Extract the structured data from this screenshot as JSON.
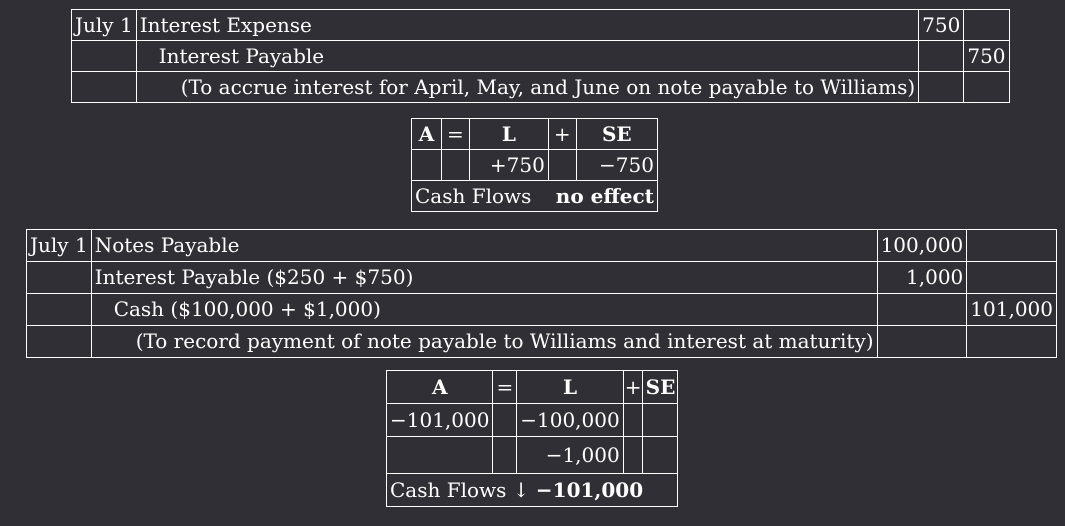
{
  "entry1": {
    "date": "July 1",
    "debit_account": "Interest Expense",
    "debit_amount": "750",
    "credit_account": "Interest Payable",
    "credit_amount": "750",
    "explanation": "(To accrue interest for April, May, and June on note payable to Williams)"
  },
  "effect1": {
    "h_a": "A",
    "h_eq": "=",
    "h_l": "L",
    "h_plus": "+",
    "h_se": "SE",
    "l_value": "+750",
    "se_value": "−750",
    "cash_label": "Cash Flows",
    "cash_value": "no effect"
  },
  "entry2": {
    "date": "July 1",
    "line1_account": "Notes Payable",
    "line1_amount": "100,000",
    "line2_account": "Interest Payable ($250 + $750)",
    "line2_amount": "1,000",
    "line3_account": "Cash ($100,000 + $1,000)",
    "line3_amount": "101,000",
    "explanation": "(To record payment of note payable to Williams and interest at maturity)"
  },
  "effect2": {
    "h_a": "A",
    "h_eq": "=",
    "h_l": "L",
    "h_plus": "+",
    "h_se": "SE",
    "a_value": "−101,000",
    "l_value1": "−100,000",
    "l_value2": "−1,000",
    "cash_label": "Cash Flows",
    "cash_arrow": "↓",
    "cash_value": "−101,000"
  }
}
